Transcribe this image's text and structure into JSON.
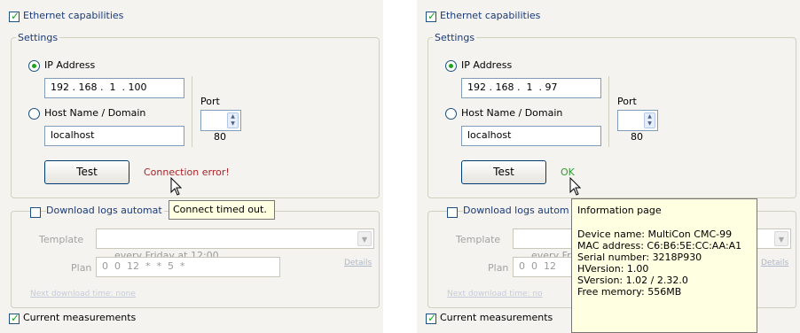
{
  "panels": [
    {
      "ethernet_label": "Ethernet capabilities",
      "settings_label": "Settings",
      "ip_label": "IP Address",
      "ip_value": "192 . 168 .  1  . 100",
      "port_label": "Port",
      "port_value": "80",
      "host_label": "Host Name / Domain",
      "host_value": "localhost",
      "test_label": "Test",
      "status_text": "Connection error!",
      "status_color": "#a8232a",
      "download_label": "Download logs automat",
      "template_label": "Template",
      "template_value": "every Friday at 12:00",
      "plan_label": "Plan",
      "plan_value": "0  0  12  *  *  5  *",
      "details_label": "Details",
      "next_download": "Next download time: none",
      "current_label": "Current measurements",
      "tooltip": {
        "title": "Connect timed out.",
        "lines": []
      }
    },
    {
      "ethernet_label": "Ethernet capabilities",
      "settings_label": "Settings",
      "ip_label": "IP Address",
      "ip_value": "192 . 168 .  1  . 97",
      "port_label": "Port",
      "port_value": "80",
      "host_label": "Host Name / Domain",
      "host_value": "localhost",
      "test_label": "Test",
      "status_text": "OK",
      "status_color": "#2f9a2f",
      "download_label": "Download logs autom",
      "template_label": "Template",
      "template_value": "every Frid",
      "plan_label": "Plan",
      "plan_value": "0  0  12",
      "details_label": "Details",
      "next_download": "Next download time: no",
      "current_label": "Current measurements",
      "tooltip": {
        "title": "Information page",
        "lines": [
          "Device name: MultiCon CMC-99",
          "MAC address: C6:B6:5E:CC:AA:A1",
          "Serial number: 3218P930",
          "HVersion: 1.00",
          "SVersion: 1.02 / 2.32.0",
          "Free memory: 556MB"
        ]
      }
    }
  ],
  "colors": {
    "accent": "#21a121",
    "label_blue": "#1a3a7a",
    "tooltip_bg": "#ffffe1"
  },
  "icons": [
    "checkbox-checked-icon",
    "radio-selected-icon",
    "spin-arrows-icon",
    "dropdown-arrow-icon",
    "mouse-pointer-icon"
  ]
}
